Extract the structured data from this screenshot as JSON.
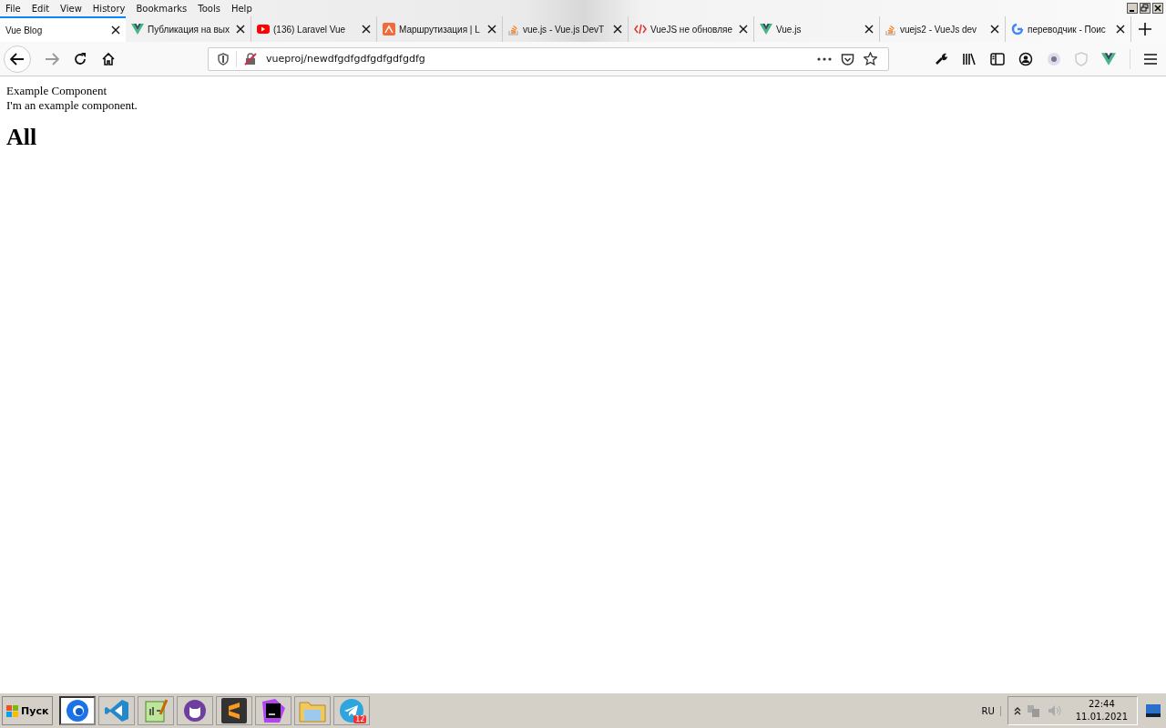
{
  "menu": [
    "File",
    "Edit",
    "View",
    "History",
    "Bookmarks",
    "Tools",
    "Help"
  ],
  "tabs": [
    {
      "label": "Vue Blog",
      "selected": true,
      "kind": "plain"
    },
    {
      "label": "Публикация на вых",
      "selected": false,
      "kind": "vue"
    },
    {
      "label": "(136) Laravel Vue",
      "selected": false,
      "kind": "youtube"
    },
    {
      "label": "Маршрутизация | L",
      "selected": false,
      "kind": "orange"
    },
    {
      "label": "vue.js - Vue.js DevT",
      "selected": false,
      "kind": "stack"
    },
    {
      "label": "VueJS не обновляе",
      "selected": false,
      "kind": "code"
    },
    {
      "label": "Vue.js",
      "selected": false,
      "kind": "vue"
    },
    {
      "label": "vuejs2 - VueJs dev",
      "selected": false,
      "kind": "stack"
    },
    {
      "label": "переводчик - Поис",
      "selected": false,
      "kind": "google"
    }
  ],
  "address": {
    "value": "vueproj/newdfgdfgdfgdfgdfgdfg"
  },
  "page": {
    "title": "Example Component",
    "text": "I'm an example component.",
    "heading": "All"
  },
  "taskbar": {
    "start": "Пуск",
    "apps": [
      {
        "kind": "firefox",
        "selected": true
      },
      {
        "kind": "vscode",
        "selected": false
      },
      {
        "kind": "notepad",
        "selected": false
      },
      {
        "kind": "cat",
        "selected": false
      },
      {
        "kind": "sublime",
        "selected": false
      },
      {
        "kind": "phpstorm",
        "selected": false
      },
      {
        "kind": "folder",
        "selected": false
      },
      {
        "kind": "telegram",
        "selected": false,
        "badge": "12"
      }
    ],
    "language": "RU",
    "time": "22:44",
    "date": "11.01.2021"
  }
}
